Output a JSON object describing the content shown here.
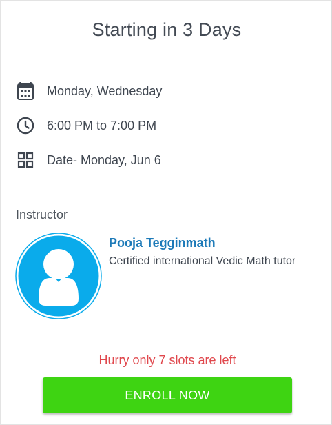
{
  "header": {
    "title": "Starting in 3 Days"
  },
  "schedule": {
    "days": {
      "icon": "calendar-icon",
      "text": "Monday, Wednesday"
    },
    "time": {
      "icon": "clock-icon",
      "text": "6:00 PM to 7:00 PM"
    },
    "date": {
      "icon": "grid-icon",
      "text": "Date- Monday, Jun 6"
    }
  },
  "instructor": {
    "label": "Instructor",
    "name": "Pooja Tegginmath",
    "description": "Certified international Vedic Math tutor",
    "avatar_icon": "user-avatar-icon"
  },
  "enrollment": {
    "urgency_text": "Hurry only 7 slots are left",
    "button_label": "ENROLL NOW"
  },
  "colors": {
    "accent_blue": "#1d7ab8",
    "avatar_blue": "#0aabeb",
    "urgency_red": "#e0484d",
    "button_green": "#3ed412"
  }
}
